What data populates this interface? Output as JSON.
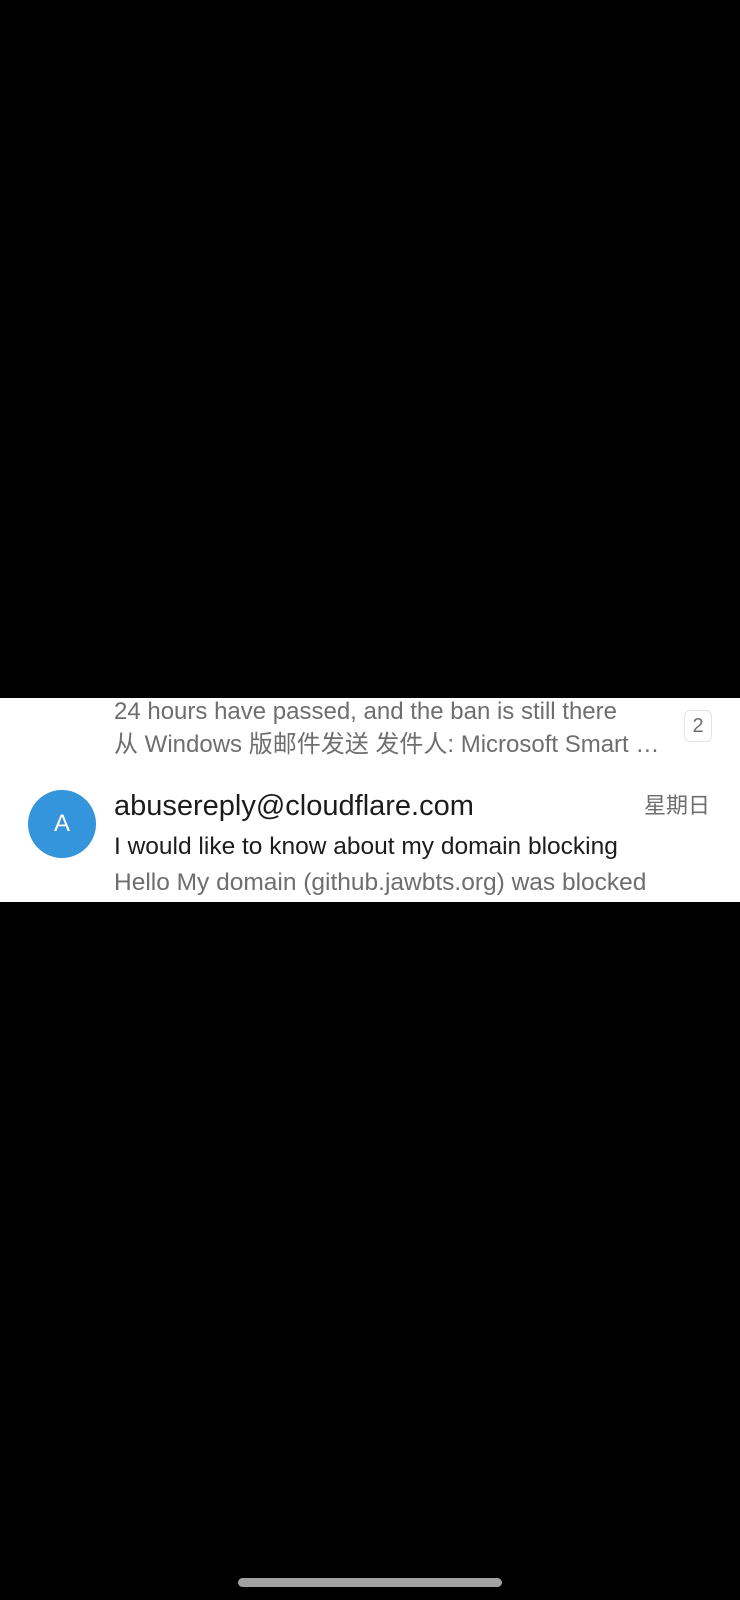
{
  "mail_list": {
    "previous_thread": {
      "subject": "24 hours have passed, and the ban is still there",
      "preview": "从 Windows 版邮件发送 发件人: Microsoft Smart Network Data Services",
      "thread_count": "2"
    },
    "message": {
      "avatar_initial": "A",
      "sender": "abusereply@cloudflare.com",
      "date": "星期日",
      "subject": "I would like to know about my domain blocking",
      "preview": "Hello My domain (github.jawbts.org) was blocked"
    }
  },
  "colors": {
    "avatar": "#3595dc",
    "primary_text": "#1c1c1c",
    "secondary_text": "#6e6e6e",
    "background": "#000000",
    "list_background": "#ffffff",
    "home_indicator": "#a2a2a2"
  }
}
